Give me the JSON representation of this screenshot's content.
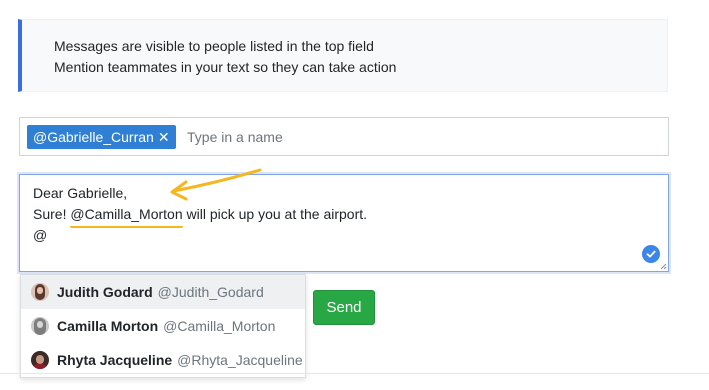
{
  "info": {
    "line1": "Messages are visible to people listed in the top field",
    "line2": "Mention teammates in your text so they can take action"
  },
  "recipients": {
    "tags": [
      {
        "label": "@Gabrielle_Curran"
      }
    ],
    "remove_glyph": "✕",
    "placeholder": "Type in a name"
  },
  "message": {
    "line1": "Dear Gabrielle,",
    "line2_prefix": "Sure! ",
    "line2_mention": "@Camilla_Morton",
    "line2_suffix": " will pick up you at the airport.",
    "line3": "@"
  },
  "suggestions": [
    {
      "name": "Judith Godard",
      "handle": "@Judith_Godard",
      "active": true
    },
    {
      "name": "Camilla Morton",
      "handle": "@Camilla_Morton",
      "active": false
    },
    {
      "name": "Rhyta Jacqueline",
      "handle": "@Rhyta_Jacqueline",
      "active": false
    }
  ],
  "actions": {
    "send_label": "Send"
  },
  "colors": {
    "accent_border": "#3b6fe0",
    "tag_bg": "#2f7fd4",
    "send_bg": "#28a745",
    "annotation": "#f6b61d"
  },
  "icons": {
    "tag_remove": "close-icon",
    "field_status": "checkmark-icon",
    "annotation": "arrow-annotation-icon"
  }
}
